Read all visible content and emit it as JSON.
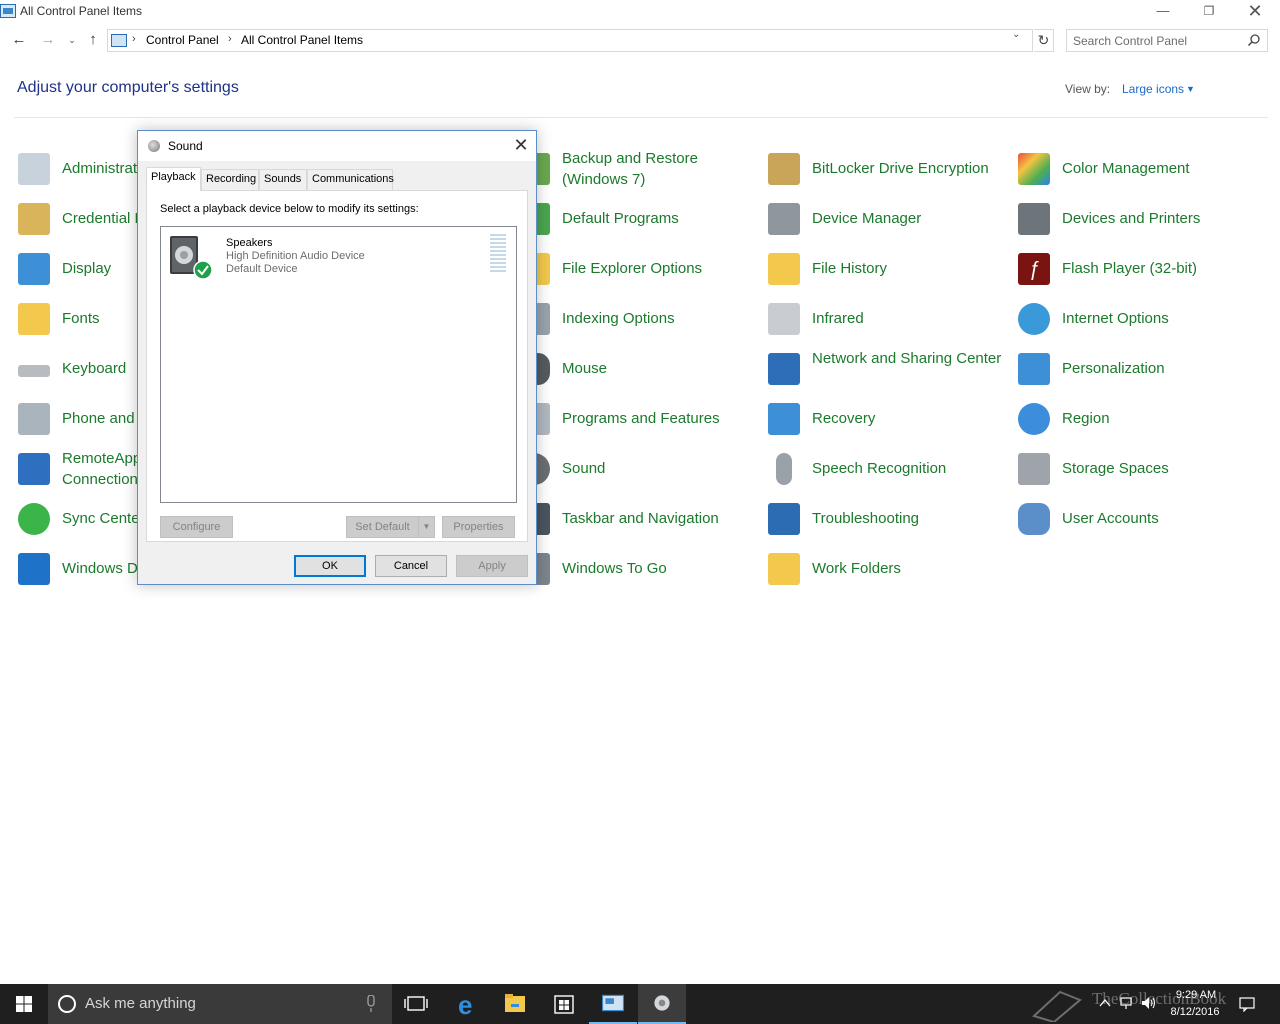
{
  "window": {
    "title": "All Control Panel Items",
    "minimize_glyph": "—",
    "maximize_glyph": "❐",
    "close_glyph": "✕"
  },
  "nav": {
    "back_glyph": "←",
    "forward_glyph": "→",
    "recent_glyph": "⌄",
    "up_glyph": "↑",
    "breadcrumb": [
      "Control Panel",
      "All Control Panel Items"
    ],
    "breadcrumb_sep": "›",
    "refresh_glyph": "↻",
    "dropdown_glyph": "⌄",
    "search_placeholder": "Search Control Panel"
  },
  "header": {
    "title": "Adjust your computer's settings",
    "view_by_label": "View by:",
    "view_by_value": "Large icons",
    "view_by_arrow": "▼"
  },
  "items": {
    "administrative_tools": "Administrative Tools",
    "backup_restore": "Backup and Restore (Windows 7)",
    "bitlocker": "BitLocker Drive Encryption",
    "color_management": "Color Management",
    "credential_manager": "Credential Manager",
    "default_programs": "Default Programs",
    "device_manager": "Device Manager",
    "devices_printers": "Devices and Printers",
    "display": "Display",
    "file_explorer_options": "File Explorer Options",
    "file_history": "File History",
    "flash_player": "Flash Player (32-bit)",
    "fonts": "Fonts",
    "indexing_options": "Indexing Options",
    "infrared": "Infrared",
    "internet_options": "Internet Options",
    "keyboard": "Keyboard",
    "mouse": "Mouse",
    "network_sharing": "Network and Sharing Center",
    "personalization": "Personalization",
    "phone_modem": "Phone and Modem",
    "programs_features": "Programs and Features",
    "recovery": "Recovery",
    "region": "Region",
    "remoteapp": "RemoteApp and Desktop Connections",
    "sound": "Sound",
    "speech_recognition": "Speech Recognition",
    "storage_spaces": "Storage Spaces",
    "sync_center": "Sync Center",
    "taskbar_navigation": "Taskbar and Navigation",
    "troubleshooting": "Troubleshooting",
    "user_accounts": "User Accounts",
    "windows_defender": "Windows Defender",
    "windows_to_go": "Windows To Go",
    "work_folders": "Work Folders"
  },
  "dialog": {
    "title": "Sound",
    "close_glyph": "✕",
    "tabs": [
      "Playback",
      "Recording",
      "Sounds",
      "Communications"
    ],
    "instruction": "Select a playback device below to modify its settings:",
    "device": {
      "name": "Speakers",
      "description": "High Definition Audio Device",
      "status": "Default Device"
    },
    "buttons": {
      "configure": "Configure",
      "set_default": "Set Default",
      "set_default_arrow": "▼",
      "properties": "Properties",
      "ok": "OK",
      "cancel": "Cancel",
      "apply": "Apply"
    }
  },
  "taskbar": {
    "search_placeholder": "Ask me anything",
    "time": "9:29 AM",
    "date": "8/12/2016",
    "watermark": "TheCollectionBook"
  },
  "colors": {
    "link_green": "#1b7a2c",
    "title_blue": "#1e3287",
    "accent_blue": "#0078d7",
    "taskbar": "#1f1f1f"
  }
}
